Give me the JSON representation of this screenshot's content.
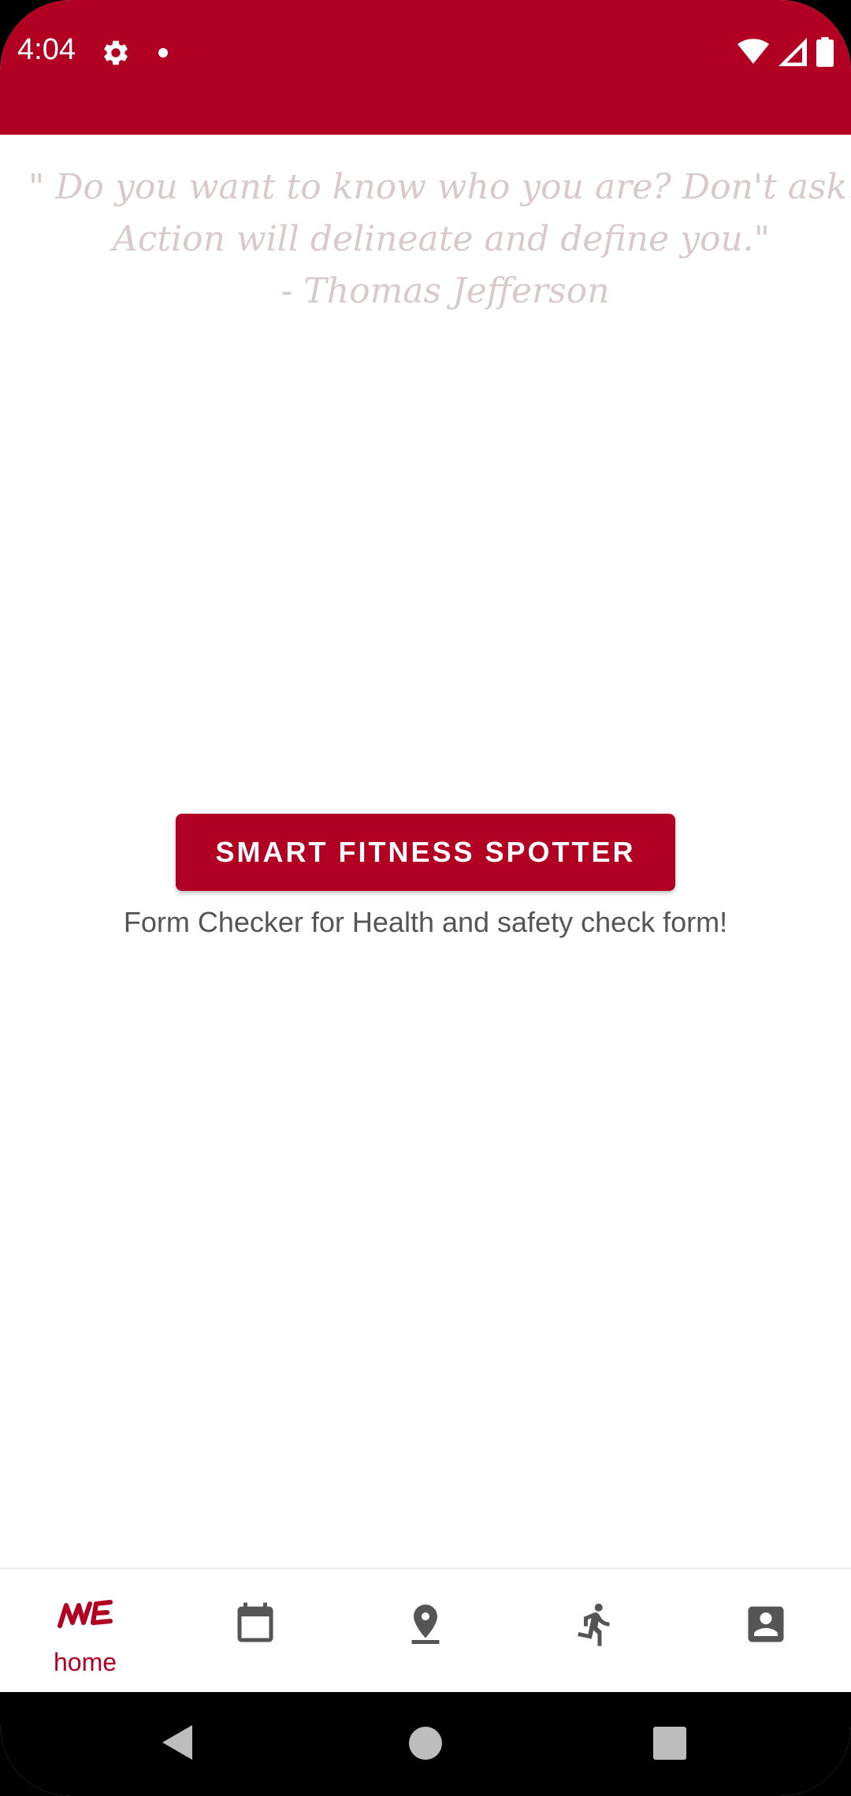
{
  "status_bar": {
    "time": "4:04",
    "icons": [
      "gear-icon",
      "notification-dot",
      "wifi-icon",
      "signal-icon",
      "battery-icon"
    ]
  },
  "theme": {
    "primary": "#b10021",
    "quote_text": "#d9c9cb",
    "subtitle_text": "#555555"
  },
  "quote": {
    "line1": "\" Do you want to know who you are? Don't ask. Action!",
    "line2": "Action will delineate and define you.\"",
    "line3": "- Thomas Jefferson"
  },
  "main": {
    "button_label": "SMART FITNESS SPOTTER",
    "subtitle": "Form Checker for Health and  safety check form!"
  },
  "bottom_nav": {
    "items": [
      {
        "icon": "home-logo-icon",
        "label": "home",
        "active": true
      },
      {
        "icon": "calendar-icon",
        "label": "",
        "active": false
      },
      {
        "icon": "location-pin-icon",
        "label": "",
        "active": false
      },
      {
        "icon": "running-person-icon",
        "label": "",
        "active": false
      },
      {
        "icon": "profile-icon",
        "label": "",
        "active": false
      }
    ]
  },
  "system_nav": {
    "buttons": [
      "back-icon",
      "home-circle-icon",
      "recents-square-icon"
    ]
  }
}
